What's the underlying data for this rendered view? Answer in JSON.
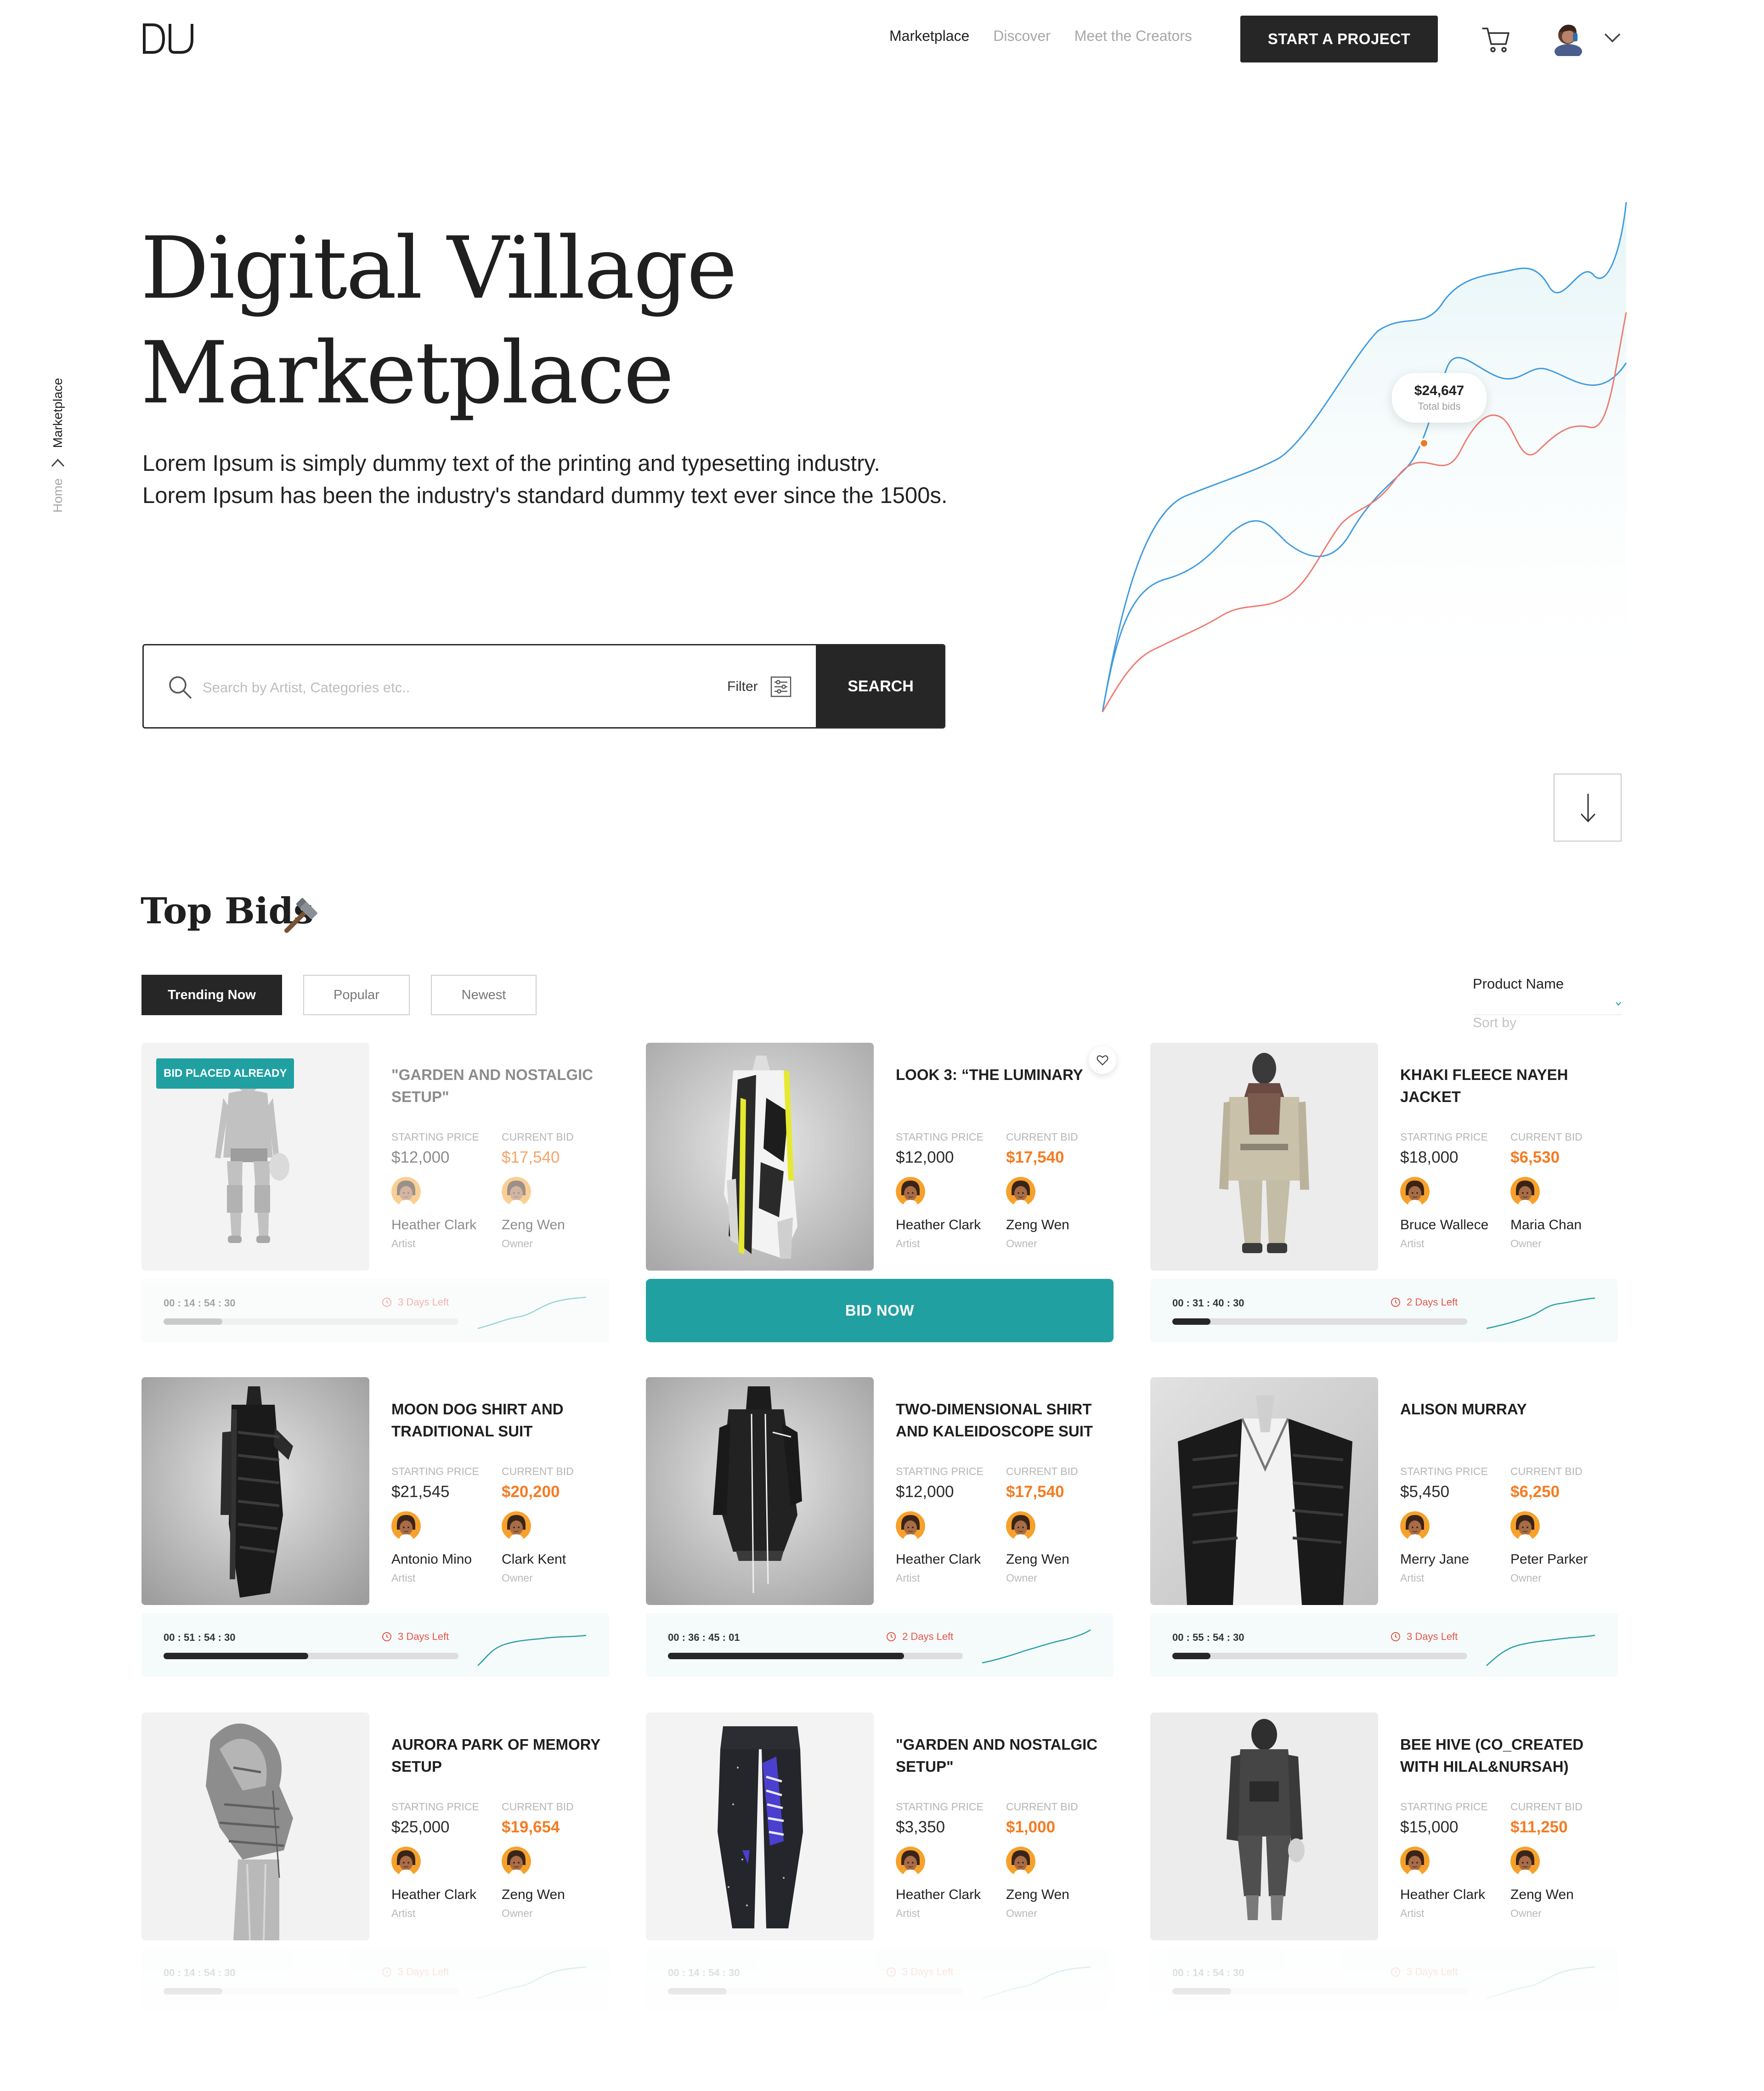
{
  "header": {
    "logo_text": "DV",
    "nav": [
      "Marketplace",
      "Discover",
      "Meet the Creators"
    ],
    "cta_label": "START A PROJECT"
  },
  "breadcrumb": {
    "home": "Home",
    "current": "Marketplace"
  },
  "hero": {
    "title_line1": "Digital Village",
    "title_line2": "Marketplace",
    "description_line1": "Lorem Ipsum is simply dummy text of the printing and typesetting industry.",
    "description_line2": "Lorem Ipsum has been the industry's standard dummy text ever since the 1500s.",
    "search_placeholder": "Search by Artist, Categories etc..",
    "filter_label": "Filter",
    "search_button": "SEARCH",
    "chart_tooltip_value": "$24,647",
    "chart_tooltip_label": "Total bids",
    "colors": {
      "line_blue": "#3e9be0",
      "line_red": "#f07a70",
      "area_fill": "#e8f6f7"
    }
  },
  "top_bids": {
    "title": "Top Bids",
    "tabs": [
      "Trending Now",
      "Popular",
      "Newest"
    ],
    "sort_label": "Product Name",
    "sort_placeholder": "Sort by",
    "starting_price_label": "STARTING PRICE",
    "current_bid_label": "CURRENT BID",
    "artist_role": "Artist",
    "owner_role": "Owner",
    "bid_now_label": "BID NOW",
    "bid_placed_label": "BID PLACED ALREADY",
    "accent_color": "#21a0a2",
    "bid_color": "#f47c24",
    "cards": [
      {
        "title": "\"GARDEN AND NOSTALGIC SETUP\"",
        "starting_price": "$12,000",
        "current_bid": "$17,540",
        "artist": "Heather Clark",
        "owner": "Zeng Wen",
        "timer": "00 : 14 : 54 : 30",
        "days_left": "3 Days Left",
        "progress": 0.2
      },
      {
        "title": "LOOK 3: “THE LUMINARY",
        "starting_price": "$12,000",
        "current_bid": "$17,540",
        "artist": "Heather Clark",
        "owner": "Zeng Wen"
      },
      {
        "title": "KHAKI FLEECE NAYEH JACKET",
        "starting_price": "$18,000",
        "current_bid": "$6,530",
        "artist": "Bruce Wallece",
        "owner": "Maria Chan",
        "timer": "00 : 31 : 40 : 30",
        "days_left": "2 Days Left",
        "progress": 0.13
      },
      {
        "title": "MOON DOG SHIRT AND TRADITIONAL SUIT",
        "starting_price": "$21,545",
        "current_bid": "$20,200",
        "artist": "Antonio Mino",
        "owner": "Clark Kent",
        "timer": "00 : 51 : 54 : 30",
        "days_left": "3 Days Left",
        "progress": 0.49
      },
      {
        "title": "TWO-DIMENSIONAL SHIRT AND KALEIDOSCOPE SUIT",
        "starting_price": "$12,000",
        "current_bid": "$17,540",
        "artist": "Heather Clark",
        "owner": "Zeng Wen",
        "timer": "00 : 36 : 45 : 01",
        "days_left": "2 Days Left",
        "progress": 0.8
      },
      {
        "title": "ALISON MURRAY",
        "starting_price": "$5,450",
        "current_bid": "$6,250",
        "artist": "Merry Jane",
        "owner": "Peter Parker",
        "timer": "00 : 55 : 54 : 30",
        "days_left": "3 Days Left",
        "progress": 0.13
      },
      {
        "title": "AURORA PARK OF MEMORY SETUP",
        "starting_price": "$25,000",
        "current_bid": "$19,654",
        "artist": "Heather Clark",
        "owner": "Zeng Wen",
        "timer": "00 : 14 : 54 : 30",
        "days_left": "3 Days Left",
        "progress": 0.2
      },
      {
        "title": "\"GARDEN AND NOSTALGIC SETUP\"",
        "starting_price": "$3,350",
        "current_bid": "$1,000",
        "artist": "Heather Clark",
        "owner": "Zeng Wen",
        "timer": "00 : 14 : 54 : 30",
        "days_left": "3 Days Left",
        "progress": 0.2
      },
      {
        "title": "BEE HIVE (CO_CREATED WITH HILAL&NURSAH)",
        "starting_price": "$15,000",
        "current_bid": "$11,250",
        "artist": "Heather Clark",
        "owner": "Zeng Wen",
        "timer": "00 : 14 : 54 : 30",
        "days_left": "3 Days Left",
        "progress": 0.2
      }
    ]
  }
}
